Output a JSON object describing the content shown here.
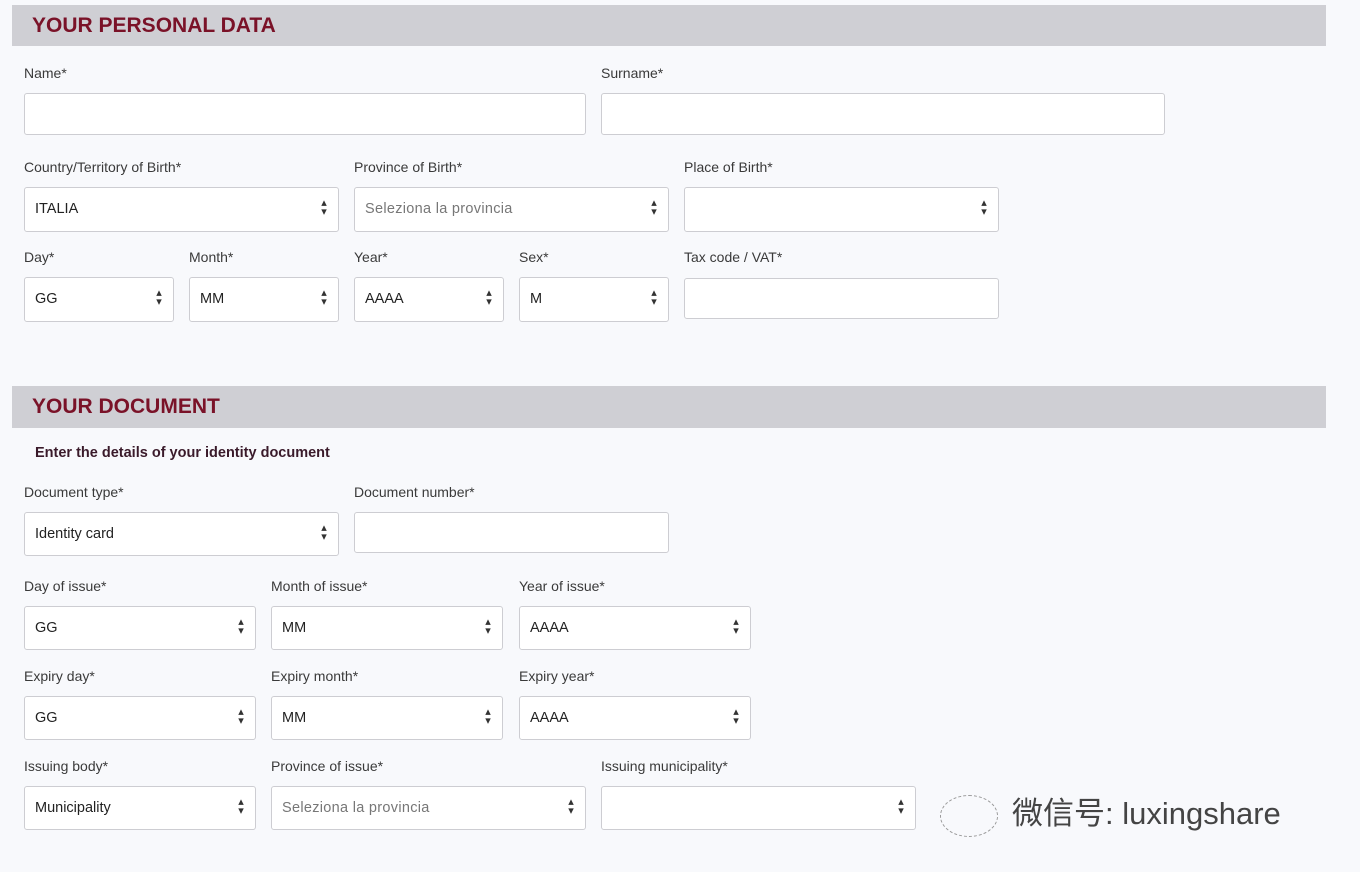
{
  "personal": {
    "title": "YOUR PERSONAL DATA",
    "name_label": "Name*",
    "surname_label": "Surname*",
    "country_label": "Country/Territory of Birth*",
    "country_value": "ITALIA",
    "province_label": "Province of Birth*",
    "province_placeholder": "Seleziona la provincia",
    "place_label": "Place of Birth*",
    "day_label": "Day*",
    "day_value": "GG",
    "month_label": "Month*",
    "month_value": "MM",
    "year_label": "Year*",
    "year_value": "AAAA",
    "sex_label": "Sex*",
    "sex_value": "M",
    "tax_label": "Tax code / VAT*"
  },
  "document": {
    "title": "YOUR DOCUMENT",
    "subtitle": "Enter the details of your identity document",
    "type_label": "Document type*",
    "type_value": "Identity card",
    "number_label": "Document number*",
    "issue_day_label": "Day of issue*",
    "issue_day_value": "GG",
    "issue_month_label": "Month of issue*",
    "issue_month_value": "MM",
    "issue_year_label": "Year of issue*",
    "issue_year_value": "AAAA",
    "exp_day_label": "Expiry day*",
    "exp_day_value": "GG",
    "exp_month_label": "Expiry month*",
    "exp_month_value": "MM",
    "exp_year_label": "Expiry year*",
    "exp_year_value": "AAAA",
    "body_label": "Issuing body*",
    "body_value": "Municipality",
    "prov_issue_label": "Province of issue*",
    "prov_issue_placeholder": "Seleziona la provincia",
    "municipality_label": "Issuing municipality*"
  },
  "watermark": {
    "text": "微信号: luxingshare",
    "icon": "wechat-icon"
  },
  "colors": {
    "header_bg": "#cfcfd4",
    "header_text": "#7a1228"
  }
}
